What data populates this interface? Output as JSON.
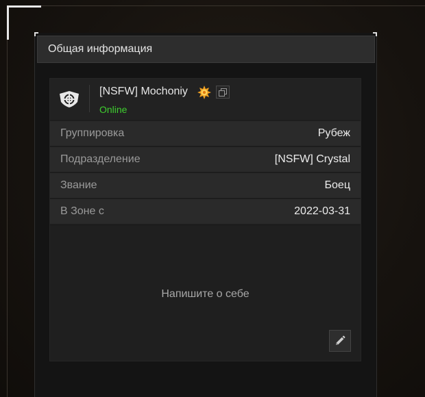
{
  "panel": {
    "title": "Общая информация"
  },
  "profile": {
    "name": "[NSFW] Mochoniy",
    "status": "Online",
    "status_color": "#3fcf2f",
    "emblem_icon": "crosshair-shield-icon",
    "badge_icon": "sun-badge-icon",
    "copy_icon": "copy-icon"
  },
  "info_rows": [
    {
      "label": "Группировка",
      "value": "Рубеж"
    },
    {
      "label": "Подразделение",
      "value": "[NSFW] Crystal"
    },
    {
      "label": "Звание",
      "value": "Боец"
    },
    {
      "label": "В Зоне с",
      "value": "2022-03-31"
    }
  ],
  "about": {
    "placeholder": "Напишите о себе",
    "edit_icon": "pencil-icon"
  },
  "colors": {
    "accent_green": "#3fcf2f",
    "badge_orange": "#f0a020"
  }
}
